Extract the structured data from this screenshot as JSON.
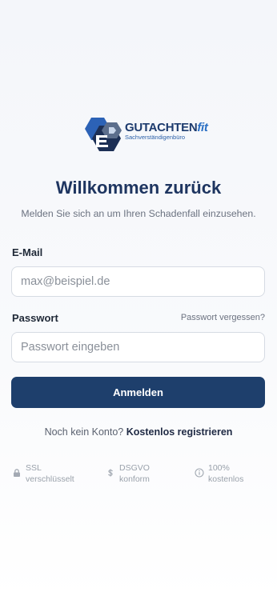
{
  "brand": {
    "name_main": "GUTACHTEN",
    "name_accent": "fit",
    "tagline": "Sachverständigenbüro"
  },
  "heading": {
    "title": "Willkommen zurück",
    "subtitle": "Melden Sie sich an um Ihren Schadenfall einzusehen."
  },
  "form": {
    "email_label": "E-Mail",
    "email_placeholder": "max@beispiel.de",
    "password_label": "Passwort",
    "password_placeholder": "Passwort eingeben",
    "forgot_link": "Passwort vergessen?",
    "submit_label": "Anmelden"
  },
  "register": {
    "prompt": "Noch kein Konto?",
    "link": "Kostenlos registrieren"
  },
  "trust_badges": [
    {
      "icon": "lock-icon",
      "line1": "SSL",
      "line2": "verschlüsselt"
    },
    {
      "icon": "dollar-icon",
      "line1": "DSGVO",
      "line2": "konform"
    },
    {
      "icon": "info-icon",
      "line1": "100%",
      "line2": "kostenlos"
    }
  ],
  "colors": {
    "primary": "#1e3f6c",
    "title": "#1e3560",
    "muted": "#6b7280",
    "brand_blue": "#2a6fc4"
  }
}
